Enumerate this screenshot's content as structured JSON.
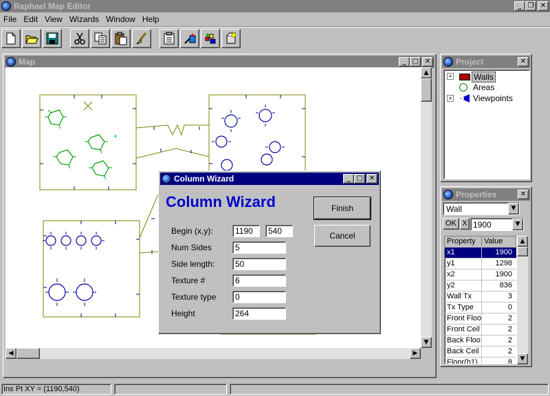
{
  "app": {
    "title": "Raphael Map Editor"
  },
  "menu": [
    "File",
    "Edit",
    "View",
    "Wizards",
    "Window",
    "Help"
  ],
  "toolbar_icons": [
    "new-file-icon",
    "open-folder-icon",
    "save-disk-icon",
    "cut-scissors-icon",
    "copy-icon",
    "paste-icon",
    "brush-icon",
    "properties-icon",
    "wizard-icon",
    "build-icon",
    "lightbulb-icon"
  ],
  "map": {
    "title": "Map"
  },
  "project": {
    "title": "Project",
    "items": [
      "Walls",
      "Areas",
      "Viewpoints"
    ]
  },
  "properties": {
    "title": "Properties",
    "object_type": "Wall",
    "ok_label": "OK",
    "cancel_x": "X",
    "value_input": "1900",
    "col_property": "Property",
    "col_value": "Value",
    "rows": [
      {
        "name": "x1",
        "value": "1900"
      },
      {
        "name": "y1",
        "value": "1298"
      },
      {
        "name": "x2",
        "value": "1900"
      },
      {
        "name": "y2",
        "value": "836"
      },
      {
        "name": "Wall Tx",
        "value": "3"
      },
      {
        "name": "Tx Type",
        "value": "0"
      },
      {
        "name": "Front Floo",
        "value": "2"
      },
      {
        "name": "Front Ceil",
        "value": "2"
      },
      {
        "name": "Back Floo",
        "value": "2"
      },
      {
        "name": "Back Ceil",
        "value": "2"
      },
      {
        "name": "Floor(h1)",
        "value": "8"
      }
    ]
  },
  "wizard": {
    "title": "Column Wizard",
    "heading": "Column Wizard",
    "finish_label": "Finish",
    "cancel_label": "Cancel",
    "begin_label": "Begin (x,y):",
    "begin_x": "1190",
    "begin_y": "540",
    "num_sides_label": "Num Sides",
    "num_sides": "5",
    "side_length_label": "Side length:",
    "side_length": "50",
    "texture_label": "Texture #",
    "texture": "6",
    "texture_type_label": "Texture type",
    "texture_type": "0",
    "height_label": "Height",
    "height": "264"
  },
  "status": {
    "text": "Ins Pt XY = (1190,540)"
  },
  "colors": {
    "titlebar": "#000080",
    "wizard_heading": "#0000cc",
    "room_outline": "#808000",
    "column_green": "#00a000",
    "column_blue": "#0000a0"
  }
}
